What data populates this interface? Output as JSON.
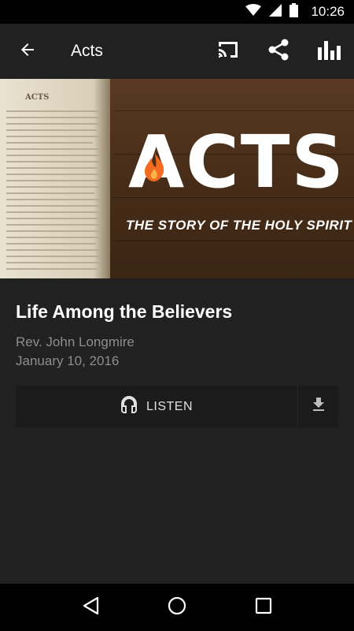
{
  "status_bar": {
    "time": "10:26"
  },
  "app_bar": {
    "title": "Acts"
  },
  "hero": {
    "book_header": "ACTS",
    "title_text": "ACTS",
    "subtitle_text": "THE STORY OF THE HOLY SPIRIT",
    "accent_color": "#f26b21"
  },
  "sermon": {
    "title": "Life Among the Believers",
    "speaker": "Rev. John Longmire",
    "date": "January 10, 2016"
  },
  "actions": {
    "listen_label": "LISTEN"
  },
  "icons": {
    "back": "arrow-left-icon",
    "cast": "cast-icon",
    "share": "share-icon",
    "stats": "bar-chart-icon",
    "listen": "headphones-icon",
    "download": "download-icon"
  },
  "colors": {
    "background": "#212121",
    "button": "#1b1b1b",
    "secondary_text": "#8e8e8e"
  }
}
